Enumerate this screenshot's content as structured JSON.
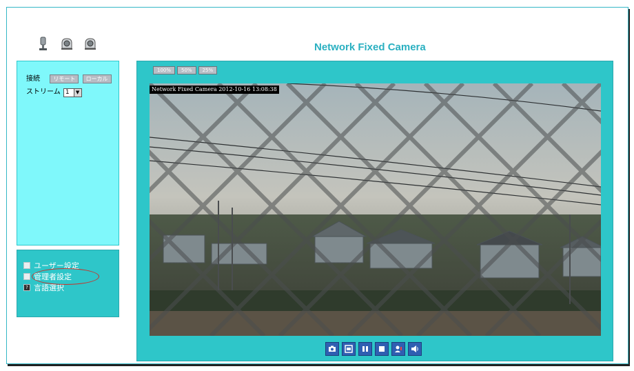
{
  "page": {
    "title": "Network Fixed Camera"
  },
  "top_icons": [
    "camera-icon",
    "ptz-camera-icon",
    "ptz-camera-icon"
  ],
  "left": {
    "connect_label": "接続",
    "connect_buttons": [
      "リモート",
      "ローカル"
    ],
    "stream_label": "ストリーム",
    "stream_value": "1"
  },
  "menu": {
    "items": [
      {
        "label": "ユーザー設定",
        "icon": "user-icon"
      },
      {
        "label": "管理者設定",
        "icon": "admin-icon"
      },
      {
        "label": "言語選択",
        "icon": "help-icon"
      }
    ]
  },
  "video": {
    "resolution_buttons": [
      "100%",
      "50%",
      "25%"
    ],
    "osd_text": "Network Fixed Camera 2012-10-16 13:08:38"
  },
  "controls": [
    "snapshot-icon",
    "record-icon",
    "pause-icon",
    "stop-icon",
    "talk-icon",
    "audio-icon"
  ],
  "colors": {
    "accent": "#2ec6c9",
    "light_panel": "#7ff8fb",
    "title": "#2ab0c1",
    "control": "#2f5fb2",
    "highlight": "#c8322a"
  }
}
